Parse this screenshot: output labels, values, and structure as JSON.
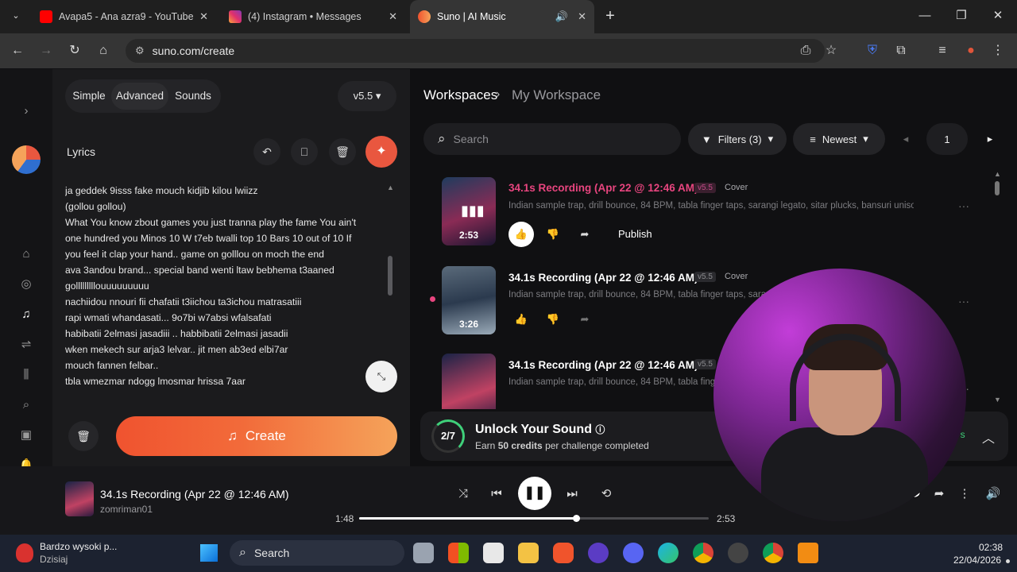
{
  "browser": {
    "tabs": [
      {
        "title": "Avapa5 - Ana azra9 - YouTube"
      },
      {
        "title": "(4) Instagram • Messages"
      },
      {
        "title": "Suno | AI Music"
      }
    ],
    "url": "suno.com/create"
  },
  "left": {
    "modes": [
      "Simple",
      "Advanced",
      "Sounds"
    ],
    "version": "v5.5",
    "lyrics_label": "Lyrics",
    "lyrics": [
      "ja geddek 9isss fake mouch kidjib kilou lwiizz",
      " (gollou gollou)",
      "What You know zbout games you just tranna play the fame You ain't",
      "one hundred you Minos 10 W t7eb twalli top 10 Bars 10 out of 10 If",
      "you feel it clap your hand.. game on golllou on  moch  the end",
      "ava 3andou brand... special band wenti ltaw bebhema t3aaned",
      "golllllllllouuuuuuuuu",
      "nachiidou nnouri fii chafatii  t3iichou ta3ichou matrasatiii",
      "rapi wmati whandasati...  9o7bi w7absi wfalsafati",
      "habibatii 2elmasi jasadiii .. habbibatii 2elmasi jasadii",
      "wken mekech sur arja3 lelvar.. jit men ab3ed elbi7ar",
      "mouch fannen felbar..",
      "tbla wmezmar ndogg lmosmar hrissa 7aar"
    ],
    "create_label": "Create"
  },
  "right": {
    "breadcrumb": {
      "root": "Workspaces",
      "current": "My Workspace"
    },
    "search_placeholder": "Search",
    "filters_label": "Filters (3)",
    "sort_label": "Newest",
    "page": "1",
    "songs": [
      {
        "title": "34.1s Recording (Apr 22 @ 12:46 AM)",
        "version": "v5.5",
        "tag": "Cover",
        "desc": "Indian sample trap, drill bounce, 84 BPM, tabla finger taps, sarangi legato, sitar plucks, bansuri uniso...",
        "duration": "2:53",
        "publish": "Publish",
        "playing": true
      },
      {
        "title": "34.1s Recording (Apr 22 @ 12:46 AM)",
        "version": "v5.5",
        "tag": "Cover",
        "desc": "Indian sample trap, drill bounce, 84 BPM, tabla finger taps, sara",
        "duration": "3:26",
        "playing": false
      },
      {
        "title": "34.1s Recording (Apr 22 @ 12:46 AM)",
        "version": "v5.5",
        "tag": "",
        "desc": "Indian sample trap, drill bounce, 84 BPM, tabla finge",
        "duration": "",
        "playing": false
      }
    ],
    "unlock": {
      "progress": "2/7",
      "title": "Unlock Your Sound",
      "sub_pre": "Earn ",
      "sub_bold": "50 credits",
      "sub_post": " per challenge completed",
      "days": "ays"
    }
  },
  "player": {
    "title": "34.1s Recording (Apr 22 @ 12:46 AM)",
    "artist": "zomriman01",
    "current": "1:48",
    "total": "2:53",
    "progress": 0.62
  },
  "taskbar": {
    "weather_title": "Bardzo wysoki p...",
    "weather_sub": "Dzisiaj",
    "search": "Search",
    "time": "02:38",
    "date": "22/04/2026"
  }
}
